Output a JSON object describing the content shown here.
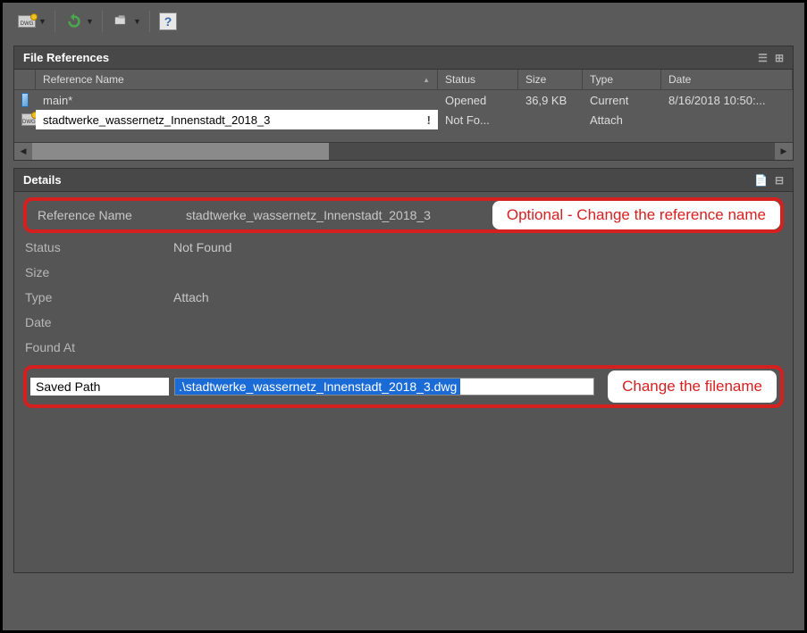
{
  "panels": {
    "file_refs_title": "File References",
    "details_title": "Details"
  },
  "columns": {
    "ref_name": "Reference Name",
    "status": "Status",
    "size": "Size",
    "type": "Type",
    "date": "Date"
  },
  "rows": [
    {
      "name": "main*",
      "status": "Opened",
      "size": "36,9 KB",
      "type": "Current",
      "date": "8/16/2018 10:50:..."
    },
    {
      "name": "stadtwerke_wassernetz_Innenstadt_2018_3",
      "status": "Not Fo...",
      "size": "",
      "type": "Attach",
      "date": ""
    }
  ],
  "details": {
    "ref_name_label": "Reference Name",
    "ref_name_value": "stadtwerke_wassernetz_Innenstadt_2018_3",
    "status_label": "Status",
    "status_value": "Not Found",
    "size_label": "Size",
    "size_value": "",
    "type_label": "Type",
    "type_value": "Attach",
    "date_label": "Date",
    "date_value": "",
    "found_at_label": "Found At",
    "found_at_value": "",
    "saved_path_label": "Saved Path",
    "saved_path_value": ".\\stadtwerke_wassernetz_Innenstadt_2018_3.dwg"
  },
  "callouts": {
    "ref_name": "Optional - Change the reference name",
    "filename": "Change the filename"
  },
  "icons": {
    "warn": "!"
  }
}
